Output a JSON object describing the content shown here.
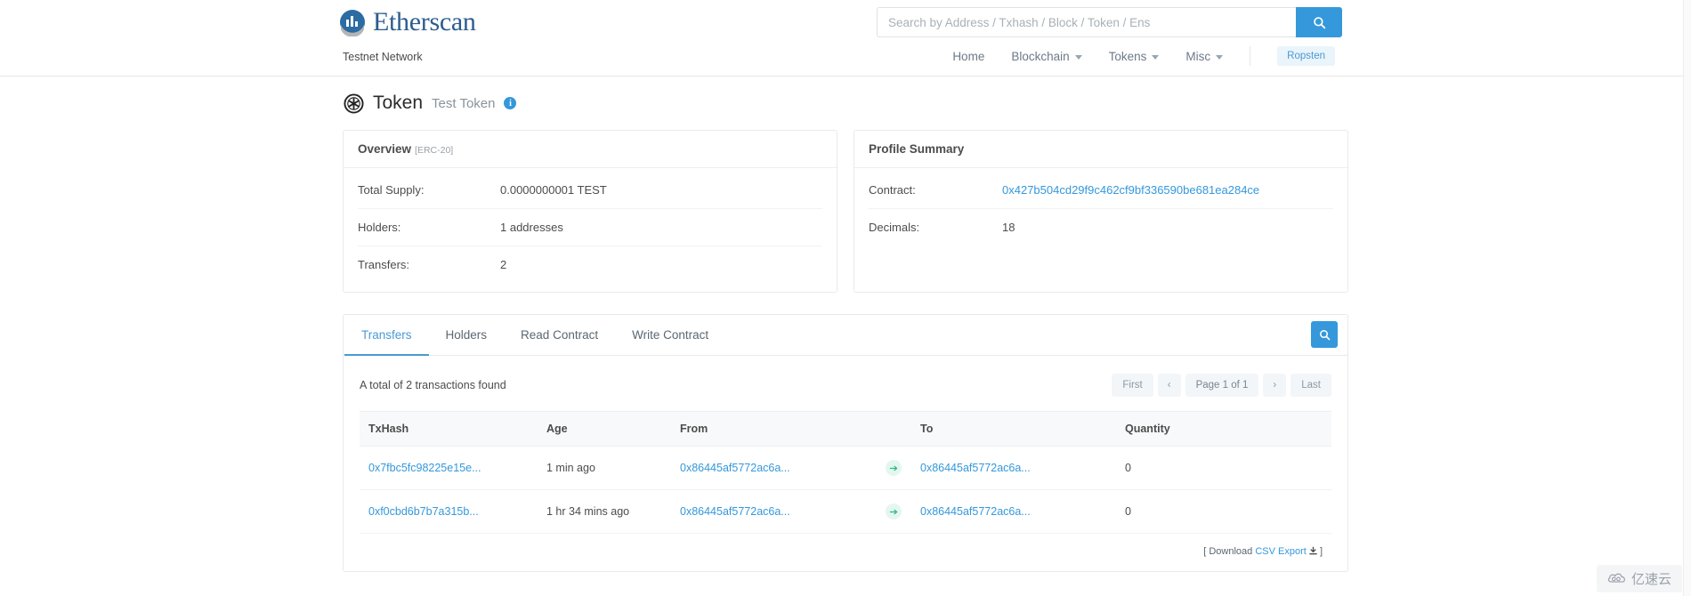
{
  "header": {
    "brand": "Etherscan",
    "brand_icon": "etherscan-logo-icon",
    "testnet_label": "Testnet Network",
    "search": {
      "placeholder": "Search by Address / Txhash / Block / Token / Ens",
      "value": "",
      "button_icon": "search-icon"
    },
    "nav": [
      {
        "label": "Home",
        "has_caret": false
      },
      {
        "label": "Blockchain",
        "has_caret": true
      },
      {
        "label": "Tokens",
        "has_caret": true
      },
      {
        "label": "Misc",
        "has_caret": true
      }
    ],
    "network_badge": "Ropsten"
  },
  "page": {
    "icon": "token-asterisk-icon",
    "title": "Token",
    "subtitle": "Test Token",
    "info_icon": "info-icon",
    "info_glyph": "i"
  },
  "overview": {
    "heading": "Overview",
    "standard": "[ERC-20]",
    "rows": [
      {
        "key": "Total Supply:",
        "value": "0.0000000001 TEST",
        "link": false
      },
      {
        "key": "Holders:",
        "value": "1 addresses",
        "link": false
      },
      {
        "key": "Transfers:",
        "value": "2",
        "link": false
      }
    ]
  },
  "profile": {
    "heading": "Profile Summary",
    "rows": [
      {
        "key": "Contract:",
        "value": "0x427b504cd29f9c462cf9bf336590be681ea284ce",
        "link": true
      },
      {
        "key": "Decimals:",
        "value": "18",
        "link": false
      }
    ]
  },
  "tabs": [
    {
      "label": "Transfers",
      "active": true
    },
    {
      "label": "Holders",
      "active": false
    },
    {
      "label": "Read Contract",
      "active": false
    },
    {
      "label": "Write Contract",
      "active": false
    }
  ],
  "tab_search_icon": "search-icon",
  "transfers": {
    "result_text": "A total of 2 transactions found",
    "pager": {
      "first": "First",
      "prev": "‹",
      "page_of": "Page 1 of 1",
      "next": "›",
      "last": "Last"
    },
    "columns": [
      "TxHash",
      "Age",
      "From",
      "",
      "To",
      "Quantity"
    ],
    "rows": [
      {
        "txhash": "0x7fbc5fc98225e15e...",
        "age": "1 min ago",
        "from": "0x86445af5772ac6a...",
        "arrow_icon": "arrow-right-icon",
        "to": "0x86445af5772ac6a...",
        "quantity": "0"
      },
      {
        "txhash": "0xf0cbd6b7b7a315b...",
        "age": "1 hr 34 mins ago",
        "from": "0x86445af5772ac6a...",
        "arrow_icon": "arrow-right-icon",
        "to": "0x86445af5772ac6a...",
        "quantity": "0"
      }
    ],
    "csv_prefix": "[ Download ",
    "csv_link": "CSV Export",
    "csv_suffix": " ]",
    "csv_icon": "download-icon"
  },
  "watermark": {
    "text": "亿速云",
    "icon": "cloud-icon"
  },
  "colors": {
    "accent_blue": "#3498db",
    "link_blue": "#3498db",
    "tab_active": "#4a9ad4",
    "arrow_green": "#2eb886"
  }
}
